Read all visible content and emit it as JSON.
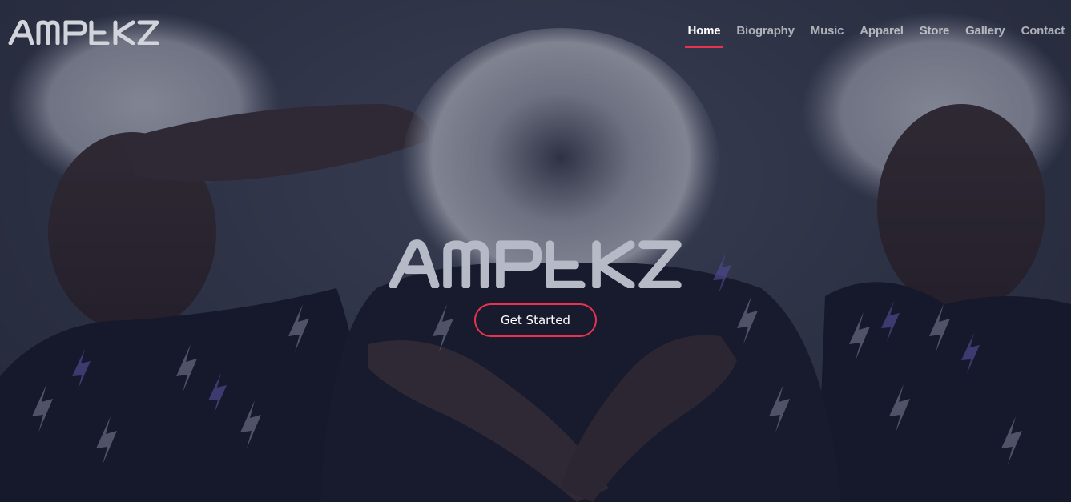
{
  "brand": {
    "name": "AMPEKZ"
  },
  "nav": {
    "items": [
      {
        "label": "Home",
        "active": true
      },
      {
        "label": "Biography",
        "active": false
      },
      {
        "label": "Music",
        "active": false
      },
      {
        "label": "Apparel",
        "active": false
      },
      {
        "label": "Store",
        "active": false
      },
      {
        "label": "Gallery",
        "active": false
      },
      {
        "label": "Contact",
        "active": false
      }
    ]
  },
  "hero": {
    "cta_label": "Get Started"
  },
  "colors": {
    "accent": "#e8334f",
    "overlay": "#2f3446",
    "nav_text": "#ffffff"
  }
}
